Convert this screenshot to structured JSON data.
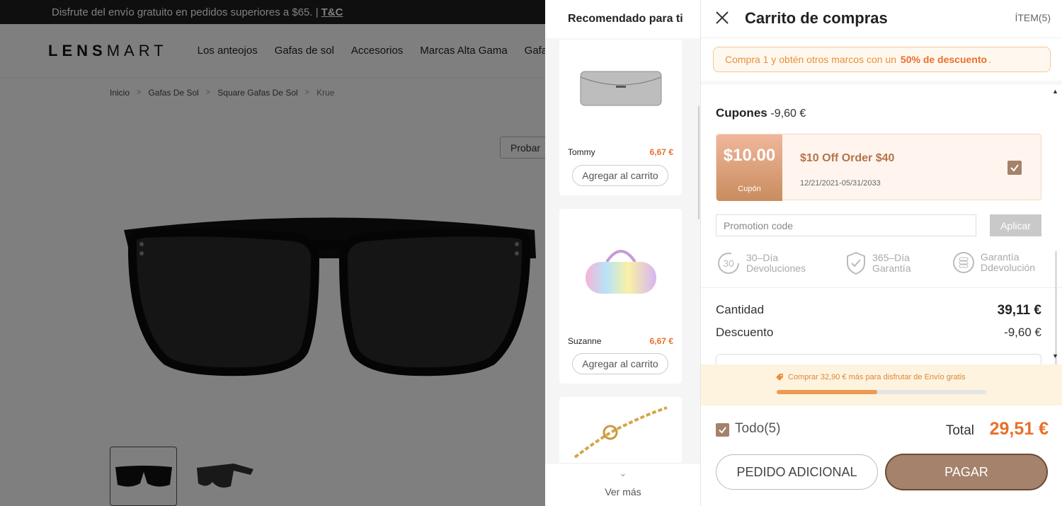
{
  "promo_bar": {
    "text": "Disfrute del envío gratuito en pedidos superiores a $65. |",
    "link": "T&C"
  },
  "header": {
    "logo_bold": "LENS",
    "logo_light": "MART",
    "nav": [
      "Los anteojos",
      "Gafas de sol",
      "Accesorios",
      "Marcas Alta Gama",
      "Gafas de"
    ]
  },
  "breadcrumb": [
    "Inicio",
    "Gafas De Sol",
    "Square Gafas De Sol",
    "Krue"
  ],
  "try_button": "Probar",
  "recommendations": {
    "title": "Recomendado para ti",
    "items": [
      {
        "name": "Tommy",
        "price": "6,67 €",
        "button": "Agregar al carrito"
      },
      {
        "name": "Suzanne",
        "price": "6,67 €",
        "button": "Agregar al carrito"
      }
    ],
    "more": "Ver más"
  },
  "cart": {
    "title": "Carrito de compras",
    "item_count": "ÍTEM(5)",
    "promo_banner": {
      "prefix": "Compra 1 y obtén otros marcos con un",
      "highlight": "50% de descuento",
      "suffix": "."
    },
    "coupons": {
      "title": "Cupones",
      "amount": "-9,60 €",
      "coupon_value": "$10.00",
      "coupon_label": "Cupón",
      "coupon_name": "$10 Off Order $40",
      "coupon_dates": "12/21/2021-05/31/2033",
      "coupon_checked": true
    },
    "promo_code": {
      "placeholder": "Promotion code",
      "apply": "Aplicar"
    },
    "guarantees": [
      {
        "icon": "30-day-return-icon",
        "badge": "30",
        "line1": "30–Día",
        "line2": "Devoluciones"
      },
      {
        "icon": "shield-check-icon",
        "line1": "365–Día",
        "line2": "Garantía"
      },
      {
        "icon": "money-coins-icon",
        "line1": "Garantía",
        "line2": "Ddevolución"
      }
    ],
    "summary": [
      {
        "label": "Cantidad",
        "value": "39,11 €"
      },
      {
        "label": "Descuento",
        "value": "-9,60 €"
      }
    ],
    "shipping": {
      "text": "Comprar 32,90 € más para disfrutar de Envío gratis",
      "progress": 0.48
    },
    "select_all": "Todo(5)",
    "total_label": "Total",
    "total_value": "29,51 €",
    "btn_additional": "PEDIDO ADICIONAL",
    "btn_pay": "PAGAR",
    "colors": {
      "accent": "#e8702a",
      "brand_brown": "#a4826b"
    }
  }
}
